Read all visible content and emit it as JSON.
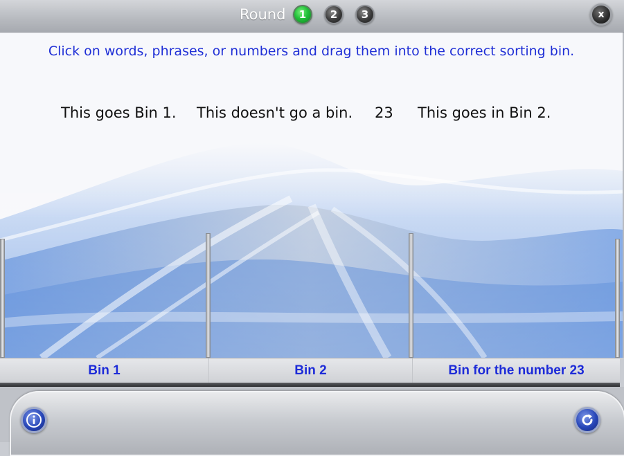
{
  "header": {
    "round_label": "Round",
    "rounds": [
      "1",
      "2",
      "3"
    ],
    "active_round": "1",
    "close_label": "x"
  },
  "instruction": "Click on words, phrases, or numbers and drag them into the correct sorting bin.",
  "items": [
    "This goes Bin 1.",
    "This doesn't go a bin.",
    "23",
    "This goes in Bin 2."
  ],
  "bins": [
    "Bin 1",
    "Bin 2",
    "Bin for the number 23"
  ],
  "footer": {
    "info_icon": "info-icon",
    "refresh_icon": "refresh-icon"
  },
  "colors": {
    "instruction_text": "#1f2fd6",
    "bin_label_text": "#1d2bd8",
    "active_round": "#22c13a"
  }
}
